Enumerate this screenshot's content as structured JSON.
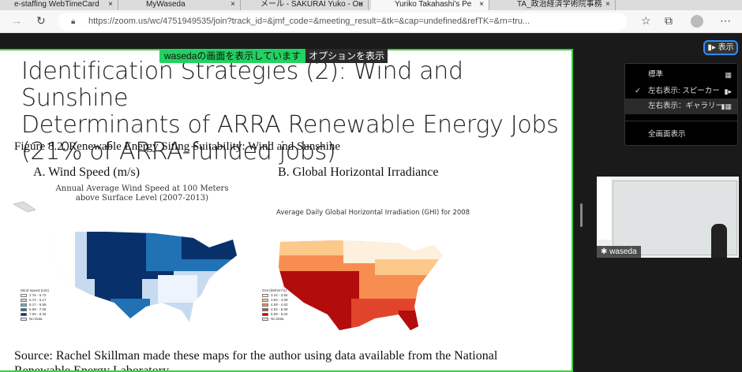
{
  "browser": {
    "tabs": [
      {
        "label": "e-staffing WebTimeCard"
      },
      {
        "label": "MyWaseda"
      },
      {
        "label": "メール - SAKURAI Yuko - Ou"
      },
      {
        "label": "Yuriko Takahashi's Pe"
      },
      {
        "label": "TA_政治経済学術院事務"
      }
    ],
    "close_glyph": "×",
    "url": "https://zoom.us/wc/4751949535/join?track_id=&jmf_code=&meeting_result=&tk=&cap=undefined&refTK=&rn=tru..."
  },
  "zoom": {
    "share_banner": "wasedaの画面を表示しています",
    "options_label": "オプションを表示",
    "view_button": "表示",
    "view_menu": [
      {
        "label": "標準",
        "checked": false
      },
      {
        "label": "左右表示: スピーカー",
        "checked": true
      },
      {
        "label": "左右表示：ギャラリー",
        "checked": false,
        "hover": true
      },
      {
        "label": "全画面表示",
        "checked": false
      }
    ],
    "check_glyph": "✓",
    "participant_name": "waseda",
    "accent": "#2d8cff",
    "share_border": "#3bd13b"
  },
  "slide": {
    "title_lines": [
      "Identification Strategies (2): Wind and Sunshine",
      "Determinants of ARRA Renewable Energy Jobs",
      "(21% of ARRA-funded jobs)"
    ],
    "figure_caption": "Figure 8.2.  Renewable Energy Siting Suitability: Wind and Sunshine",
    "panel_a": {
      "heading": "A.  Wind Speed (m/s)",
      "map_title_1": "Annual Average Wind Speed at 100 Meters",
      "map_title_2": "above Surface Level (2007-2013)",
      "legend_title": "Wind Speed (m/s)",
      "legend": [
        {
          "label": "2.76 - 5.72",
          "color": "#ffffff"
        },
        {
          "label": "5.72 - 6.17",
          "color": "#c6dbef"
        },
        {
          "label": "6.17 - 6.59",
          "color": "#6baed6"
        },
        {
          "label": "6.59 - 7.06",
          "color": "#2171b5"
        },
        {
          "label": "7.06 - 8.34",
          "color": "#08306b"
        },
        {
          "label": "No Data",
          "color": "#e6e6e6"
        }
      ]
    },
    "panel_b": {
      "heading": "B.  Global Horizontal Irradiance",
      "map_title": "Average Daily Global Horizontal Irradiation (GHI) for 2008",
      "legend_title": "GHI (kWh/m^2)",
      "legend": [
        {
          "label": "3.24 - 3.94",
          "color": "#fdf0dc"
        },
        {
          "label": "3.94 - 4.08",
          "color": "#fdc98a"
        },
        {
          "label": "4.08 - 4.52",
          "color": "#f88d52"
        },
        {
          "label": "4.52 - 5.08",
          "color": "#e0452c"
        },
        {
          "label": "5.08 - 6.04",
          "color": "#b30c0c"
        },
        {
          "label": "No Data",
          "color": "#e6e6e6"
        }
      ]
    },
    "source": "Source: Rachel Skillman made these maps for the author using data available from the National Renewable Energy Laboratory"
  }
}
